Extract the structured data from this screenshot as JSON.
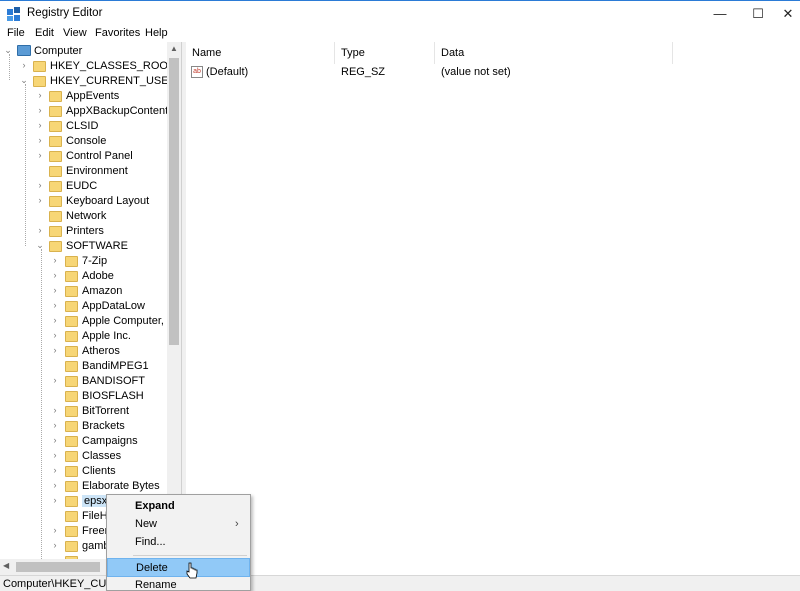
{
  "window": {
    "title": "Registry Editor",
    "minimize_glyph": "—",
    "maximize_glyph": "☐",
    "close_glyph": "✕"
  },
  "menu": [
    "File",
    "Edit",
    "View",
    "Favorites",
    "Help"
  ],
  "tree": {
    "root": "Computer",
    "hives": [
      "HKEY_CLASSES_ROOT",
      "HKEY_CURRENT_USER"
    ],
    "hkcu_children": [
      "AppEvents",
      "AppXBackupContentTy",
      "CLSID",
      "Console",
      "Control Panel",
      "Environment",
      "EUDC",
      "Keyboard Layout",
      "Network",
      "Printers",
      "SOFTWARE"
    ],
    "software_children": [
      "7-Zip",
      "Adobe",
      "Amazon",
      "AppDataLow",
      "Apple Computer, Ir",
      "Apple Inc.",
      "Atheros",
      "BandiMPEG1",
      "BANDISOFT",
      "BIOSFLASH",
      "BitTorrent",
      "Brackets",
      "Campaigns",
      "Classes",
      "Clients",
      "Elaborate Bytes",
      "epsxe",
      "FileHi",
      "Freem",
      "gamb"
    ]
  },
  "list": {
    "columns": [
      "Name",
      "Type",
      "Data"
    ],
    "rows": [
      {
        "name": "(Default)",
        "type": "REG_SZ",
        "data": "(value not set)",
        "icon": "ab-string-icon"
      }
    ]
  },
  "status": {
    "path": "Computer\\HKEY_CURR"
  },
  "context_menu": {
    "items": [
      "Expand",
      "New",
      "Find...",
      "Delete",
      "Rename"
    ],
    "submenu_arrow": "›",
    "highlighted": "Delete"
  },
  "colors": {
    "selection": "#cce4f7",
    "menu_highlight": "#91c9f7",
    "folder": "#f7d676",
    "title_accent": "#2b7bd6"
  }
}
